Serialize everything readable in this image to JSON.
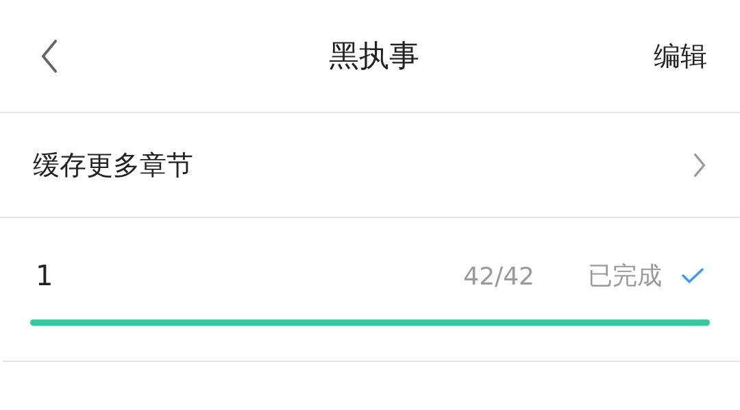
{
  "header": {
    "title": "黑执事",
    "action": "编辑"
  },
  "more_row": {
    "label": "缓存更多章节"
  },
  "downloads": [
    {
      "name": "1",
      "progress": "42/42",
      "status": "已完成",
      "completed": true,
      "level": 1
    }
  ]
}
